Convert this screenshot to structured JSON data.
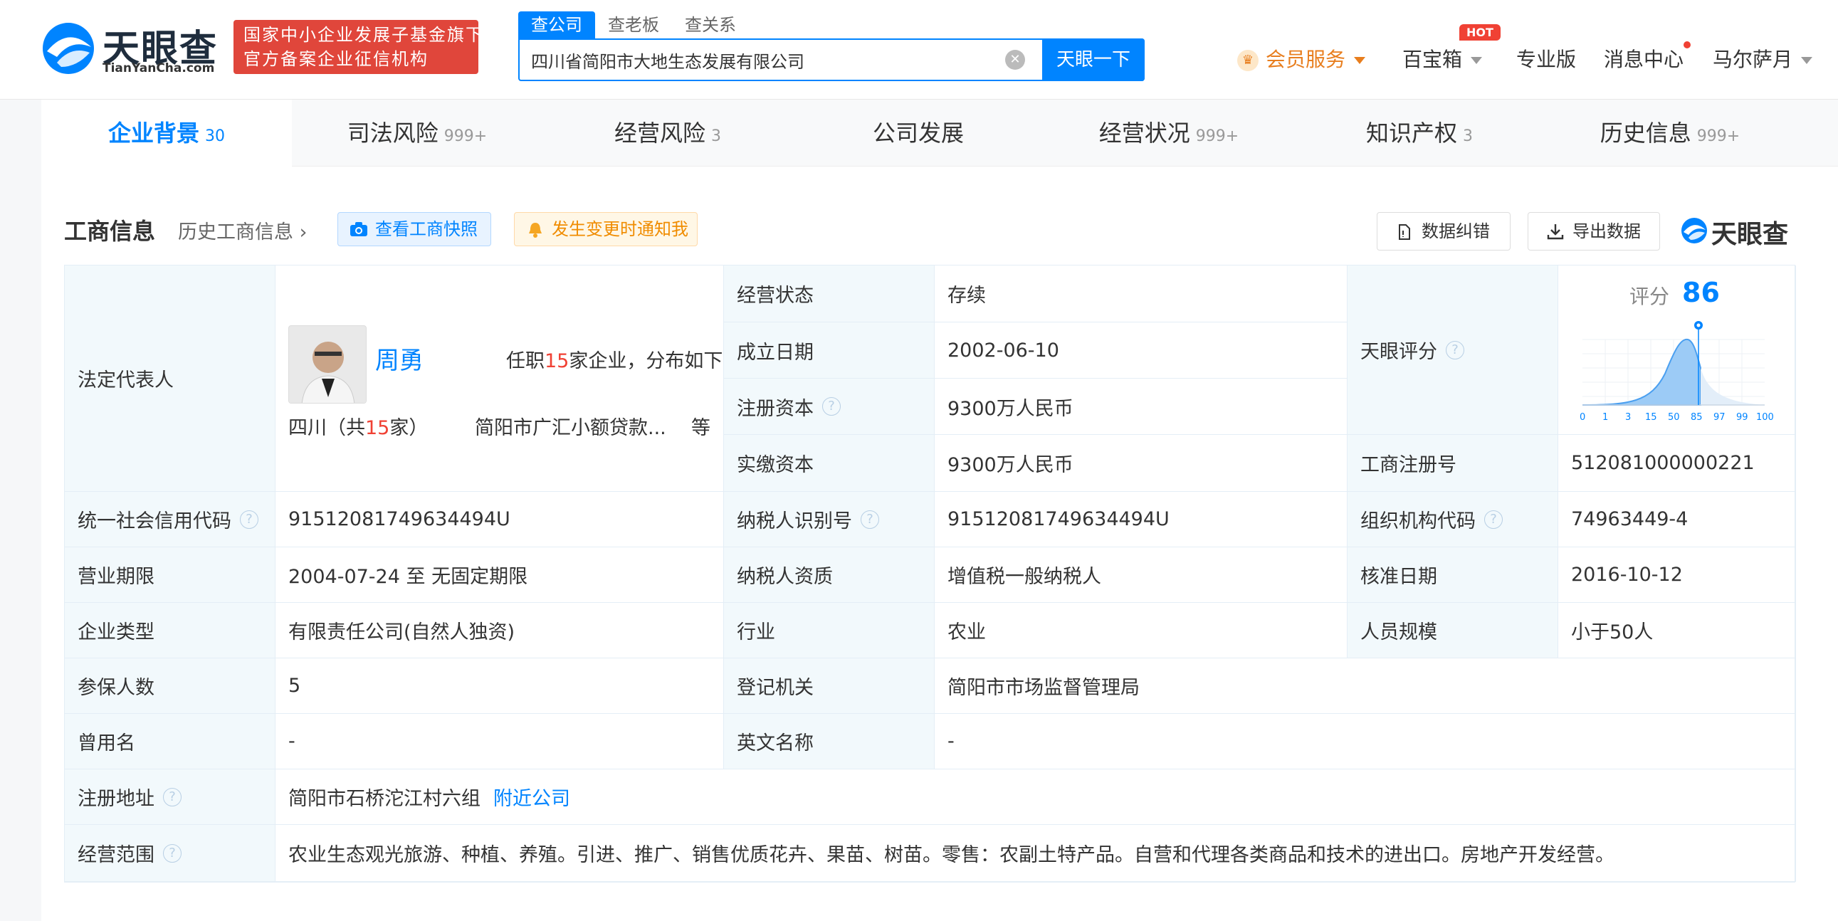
{
  "header": {
    "logo_text": "天眼查",
    "logo_sub": "TianYanCha.com",
    "badge_line1": "国家中小企业发展子基金旗下",
    "badge_line2": "官方备案企业征信机构",
    "search_tabs": [
      "查公司",
      "查老板",
      "查关系"
    ],
    "search_value": "四川省简阳市大地生态发展有限公司",
    "search_button": "天眼一下",
    "nav": {
      "vip": "会员服务",
      "baobao": "百宝箱",
      "hot": "HOT",
      "pro": "专业版",
      "messages": "消息中心",
      "user": "马尔萨月"
    }
  },
  "tabs": [
    {
      "label": "企业背景",
      "count": "30"
    },
    {
      "label": "司法风险",
      "count": "999+"
    },
    {
      "label": "经营风险",
      "count": "3"
    },
    {
      "label": "公司发展",
      "count": ""
    },
    {
      "label": "经营状况",
      "count": "999+"
    },
    {
      "label": "知识产权",
      "count": "3"
    },
    {
      "label": "历史信息",
      "count": "999+"
    }
  ],
  "section": {
    "title": "工商信息",
    "history_link": "历史工商信息",
    "snapshot_button": "查看工商快照",
    "notify_button": "发生变更时通知我",
    "error_button": "数据纠错",
    "export_button": "导出数据",
    "watermark": "天眼查"
  },
  "info": {
    "legal_rep_label": "法定代表人",
    "legal_rep_name": "周勇",
    "legal_rep_pre": "任职",
    "legal_rep_count": "15",
    "legal_rep_post": "家企业，分布如下",
    "region_pre": "四川（共",
    "region_count": "15",
    "region_post": "家）",
    "region_company": "简阳市广汇小额贷款...",
    "region_more": "等",
    "status_label": "经营状态",
    "status": "存续",
    "founded_label": "成立日期",
    "founded": "2002-06-10",
    "reg_capital_label": "注册资本",
    "reg_capital": "9300万人民币",
    "paid_capital_label": "实缴资本",
    "paid_capital": "9300万人民币",
    "score_label": "天眼评分",
    "score_title": "评分",
    "score_value": "86",
    "score_ticks": [
      "0",
      "1",
      "3",
      "15",
      "50",
      "85",
      "97",
      "99",
      "100"
    ],
    "biz_reg_no_label": "工商注册号",
    "biz_reg_no": "512081000000221",
    "credit_code_label": "统一社会信用代码",
    "credit_code": "91512081749634494U",
    "taxpayer_id_label": "纳税人识别号",
    "taxpayer_id": "91512081749634494U",
    "org_code_label": "组织机构代码",
    "org_code": "74963449-4",
    "term_label": "营业期限",
    "term": "2004-07-24 至 无固定期限",
    "taxpayer_qual_label": "纳税人资质",
    "taxpayer_qual": "增值税一般纳税人",
    "approval_date_label": "核准日期",
    "approval_date": "2016-10-12",
    "company_type_label": "企业类型",
    "company_type": "有限责任公司(自然人独资)",
    "industry_label": "行业",
    "industry": "农业",
    "staff_size_label": "人员规模",
    "staff_size": "小于50人",
    "insured_label": "参保人数",
    "insured": "5",
    "reg_authority_label": "登记机关",
    "reg_authority": "简阳市市场监督管理局",
    "former_name_label": "曾用名",
    "former_name": "-",
    "english_name_label": "英文名称",
    "english_name": "-",
    "address_label": "注册地址",
    "address": "简阳市石桥沱江村六组",
    "nearby_link": "附近公司",
    "scope_label": "经营范围",
    "scope": "农业生态观光旅游、种植、养殖。引进、推广、销售优质花卉、果苗、树苗。零售：农副土特产品。自营和代理各类商品和技术的进出口。房地产开发经营。"
  },
  "colors": {
    "brand": "#0084ff",
    "accent_red": "#f04134",
    "vip": "#e87e1e"
  }
}
